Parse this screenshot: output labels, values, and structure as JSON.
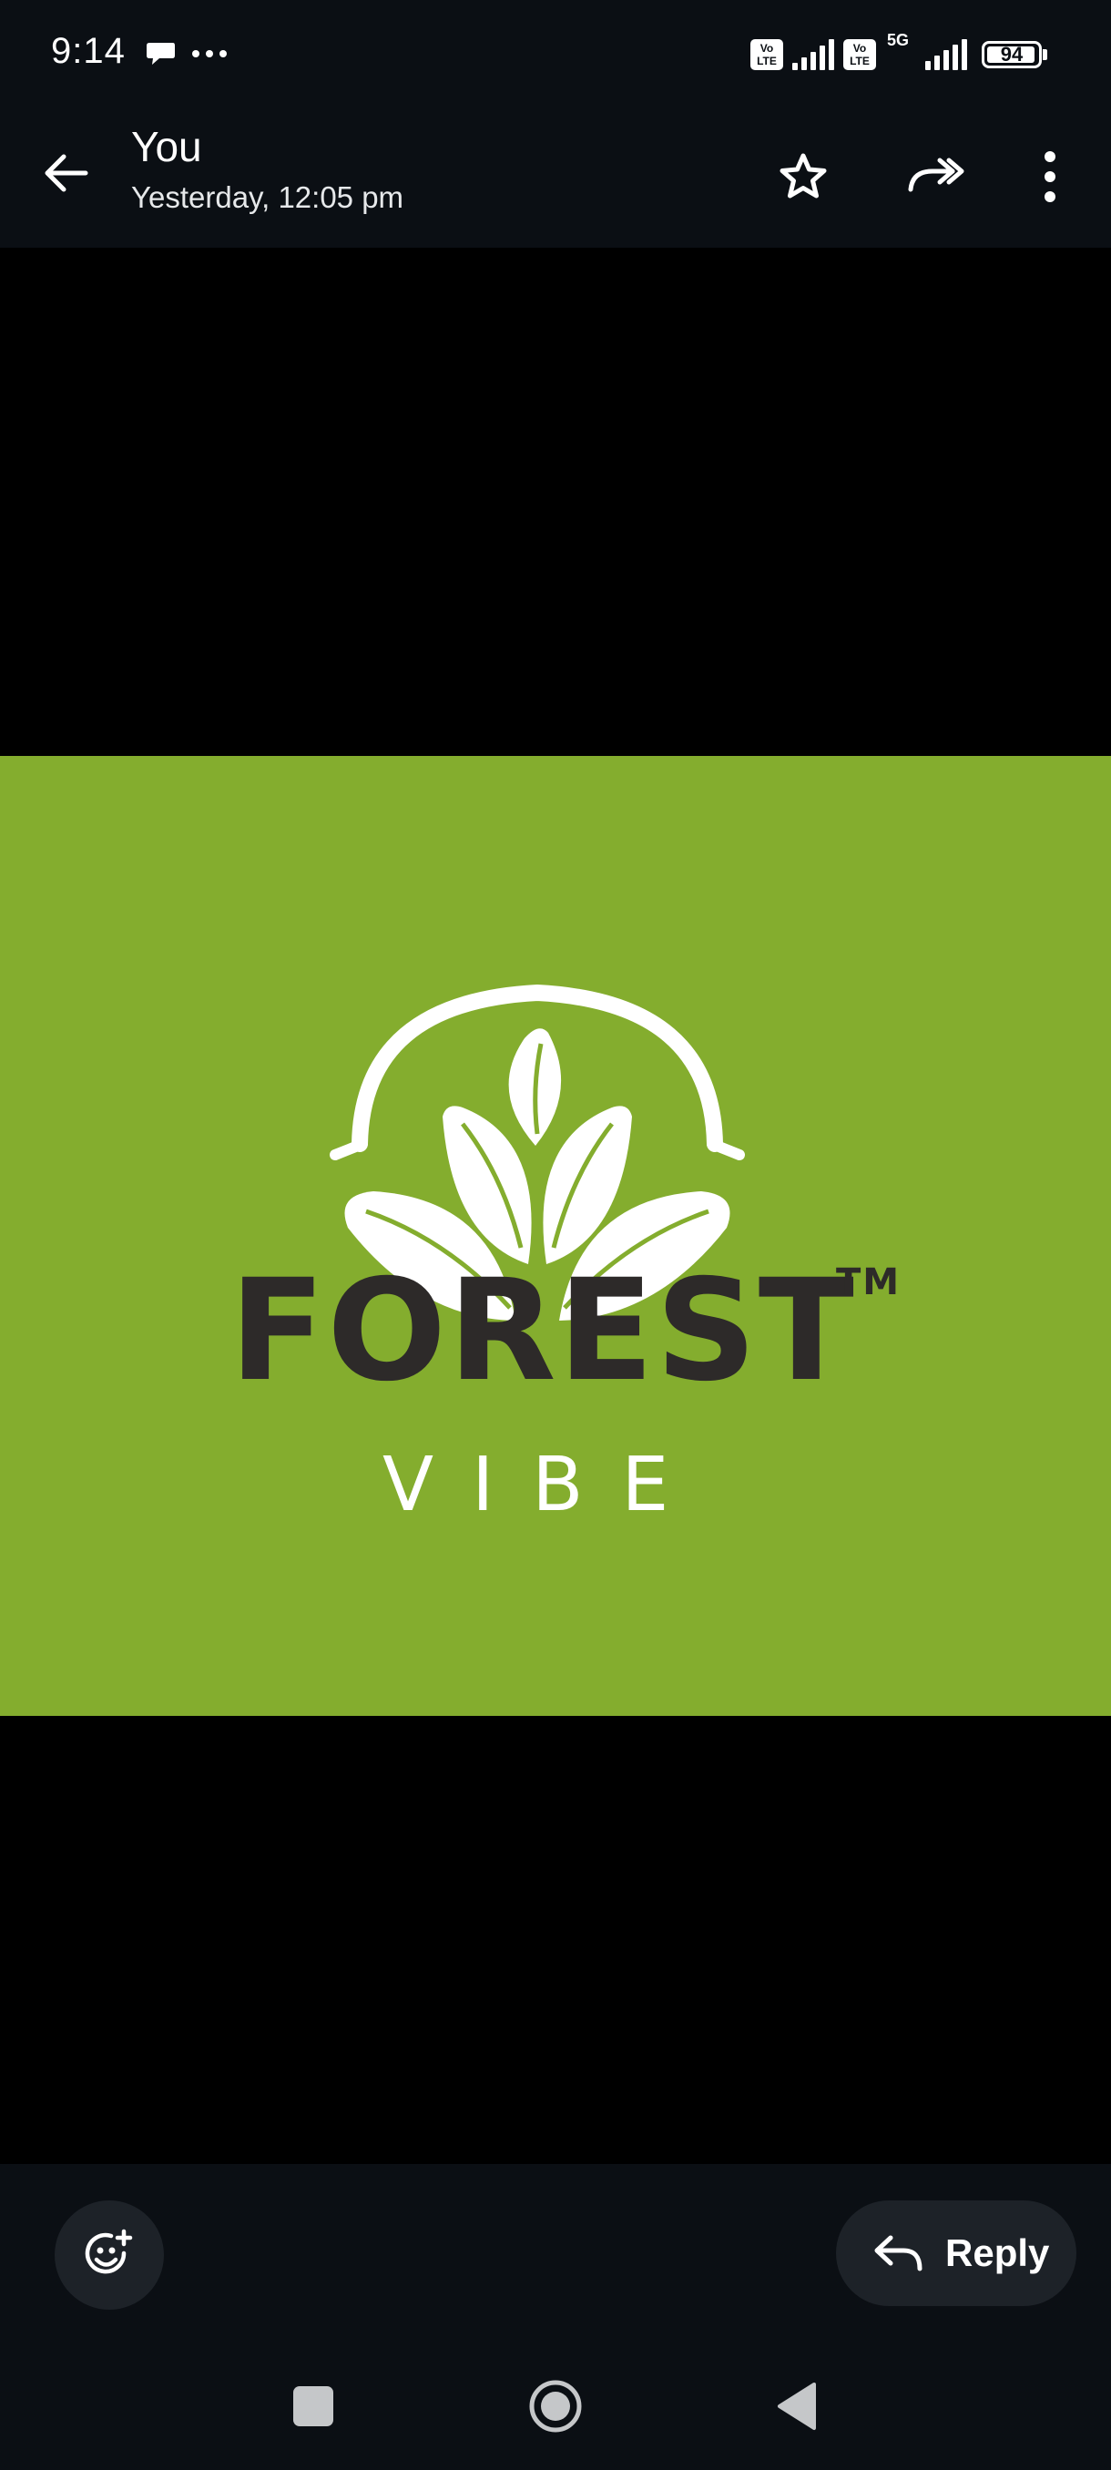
{
  "status_bar": {
    "time": "9:14",
    "volte_label": "Vo LTE",
    "network_label": "5G",
    "battery_level": "94",
    "icons": [
      "chat-notification-icon",
      "more-notifications-icon",
      "volte-icon",
      "signal-icon",
      "5g-icon",
      "battery-icon"
    ]
  },
  "header": {
    "sender": "You",
    "timestamp": "Yesterday, 12:05 pm",
    "icons": [
      "back-arrow-icon",
      "star-icon",
      "forward-icon",
      "more-vert-icon"
    ]
  },
  "media": {
    "logo_word": "FOREST",
    "logo_tm": "TM",
    "logo_sub": "VIBE",
    "colors": {
      "background": "#84ad2e",
      "word": "#2d2a29",
      "emblem": "#ffffff"
    }
  },
  "footer": {
    "reply_label": "Reply",
    "icons": [
      "add-reaction-icon",
      "reply-icon"
    ]
  },
  "nav_bar": {
    "icons": [
      "recents-icon",
      "home-icon",
      "back-triangle-icon"
    ]
  },
  "colors": {
    "bars": "#0b0f14",
    "pill": "#1d2228",
    "media_letterbox": "#000000"
  }
}
